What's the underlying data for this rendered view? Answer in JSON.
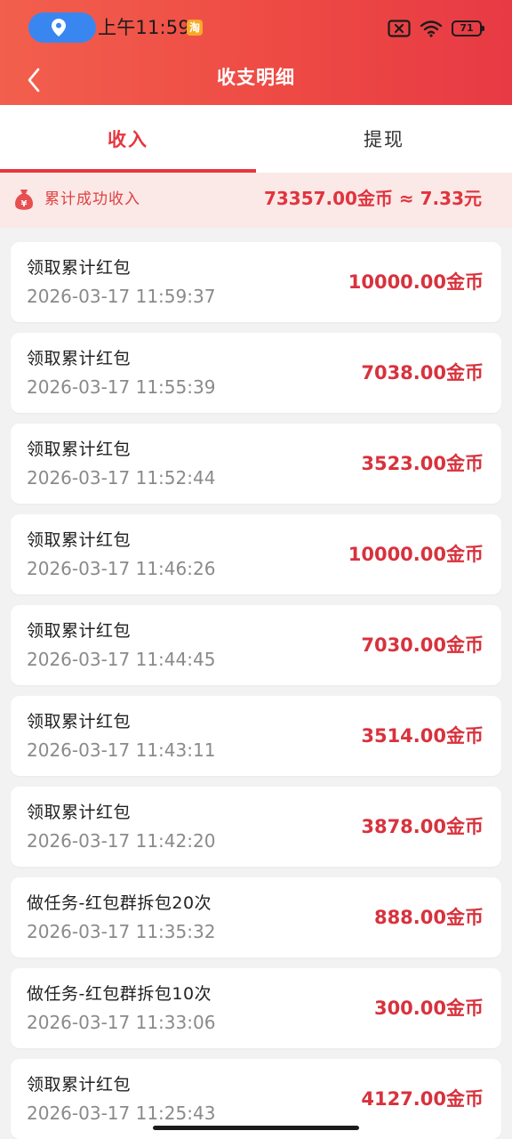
{
  "status_bar": {
    "time": "上午11:59",
    "taobao_badge": "淘",
    "battery": "71",
    "icons": [
      "location-icon",
      "sim-off-icon",
      "wifi-icon",
      "battery-icon"
    ]
  },
  "nav": {
    "title": "收支明细",
    "back_icon": "chevron-left-icon"
  },
  "tabs": [
    {
      "label": "收入",
      "active": true
    },
    {
      "label": "提现",
      "active": false
    }
  ],
  "summary": {
    "icon": "money-bag-icon",
    "label": "累计成功收入",
    "value": "73357.00金币 ≈ 7.33元"
  },
  "records": [
    {
      "title": "领取累计红包",
      "time": "2026-03-17 11:59:37",
      "amount": "10000.00金币"
    },
    {
      "title": "领取累计红包",
      "time": "2026-03-17 11:55:39",
      "amount": "7038.00金币"
    },
    {
      "title": "领取累计红包",
      "time": "2026-03-17 11:52:44",
      "amount": "3523.00金币"
    },
    {
      "title": "领取累计红包",
      "time": "2026-03-17 11:46:26",
      "amount": "10000.00金币"
    },
    {
      "title": "领取累计红包",
      "time": "2026-03-17 11:44:45",
      "amount": "7030.00金币"
    },
    {
      "title": "领取累计红包",
      "time": "2026-03-17 11:43:11",
      "amount": "3514.00金币"
    },
    {
      "title": "领取累计红包",
      "time": "2026-03-17 11:42:20",
      "amount": "3878.00金币"
    },
    {
      "title": "做任务-红包群拆包20次",
      "time": "2026-03-17 11:35:32",
      "amount": "888.00金币"
    },
    {
      "title": "做任务-红包群拆包10次",
      "time": "2026-03-17 11:33:06",
      "amount": "300.00金币"
    },
    {
      "title": "领取累计红包",
      "time": "2026-03-17 11:25:43",
      "amount": "4127.00金币"
    }
  ],
  "colors": {
    "header_start": "#f25f4d",
    "header_end": "#e73a45",
    "accent": "#e8353f",
    "summary_bg": "#fbe9e7",
    "page_bg": "#f2f2f2"
  }
}
